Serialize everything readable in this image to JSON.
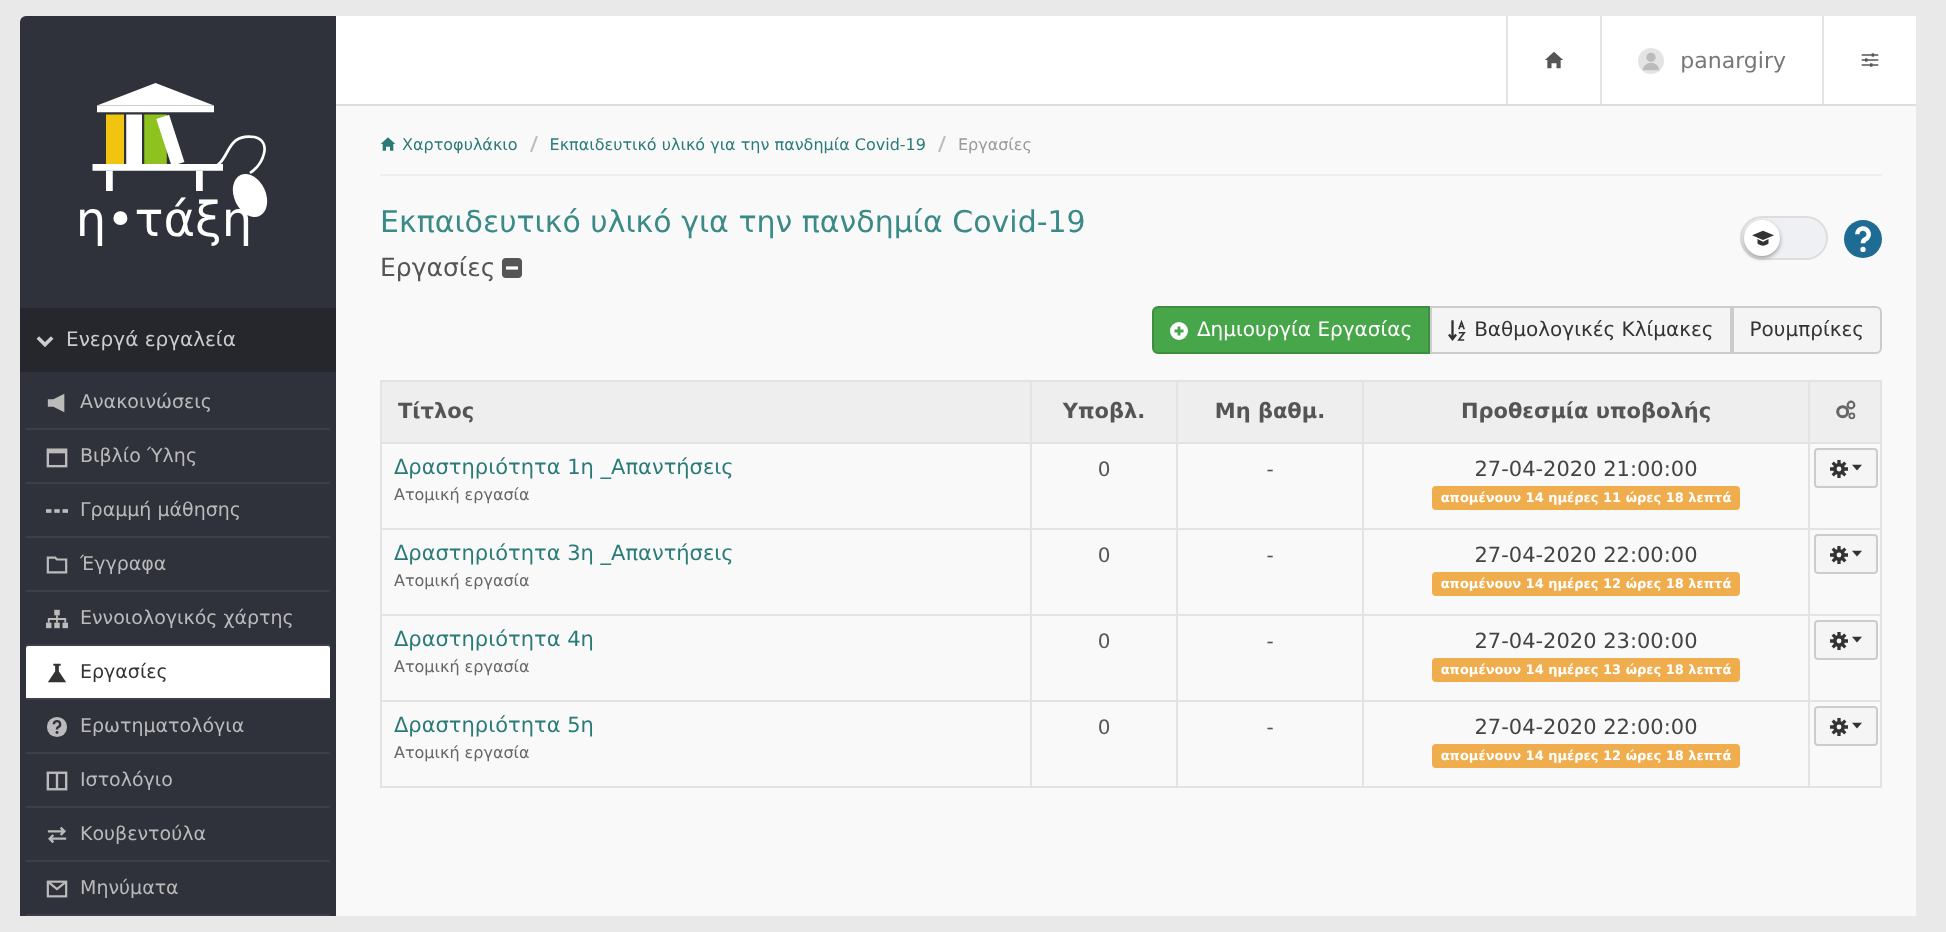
{
  "logo_text": "η•τάξη",
  "sidebar": {
    "section": {
      "label": "Ενεργά εργαλεία",
      "expanded": true
    },
    "items": [
      {
        "label": "Ανακοινώσεις",
        "selected": false
      },
      {
        "label": "Βιβλίο Ύλης",
        "selected": false
      },
      {
        "label": "Γραμμή μάθησης",
        "selected": false
      },
      {
        "label": "Έγγραφα",
        "selected": false
      },
      {
        "label": "Εννοιολογικός χάρτης",
        "selected": false
      },
      {
        "label": "Εργασίες",
        "selected": true
      },
      {
        "label": "Ερωτηματολόγια",
        "selected": false
      },
      {
        "label": "Ιστολόγιο",
        "selected": false
      },
      {
        "label": "Κουβεντούλα",
        "selected": false
      },
      {
        "label": "Μηνύματα",
        "selected": false
      }
    ]
  },
  "topbar": {
    "user": "panargiry"
  },
  "breadcrumb": [
    "Χαρτοφυλάκιο",
    "Εκπαιδευτικό υλικό για την πανδημία Covid-19",
    "Εργασίες"
  ],
  "title": "Εκπαιδευτικό υλικό για την πανδημία Covid-19",
  "subtitle": "Εργασίες",
  "toggle": {
    "on": false
  },
  "buttons": [
    {
      "label": "Δημιουργία Εργασίας",
      "kind": "primary"
    },
    {
      "label": "Βαθμολογικές Κλίμακες",
      "kind": "sort"
    },
    {
      "label": "Ρουμπρίκες",
      "kind": "plain"
    }
  ],
  "table": {
    "columns": [
      "Τίτλος",
      "Υποβλ.",
      "Μη βαθμ.",
      "Προθεσμία υποβολής"
    ],
    "rows": [
      {
        "title": "Δραστηριότητα 1η _Απαντήσεις",
        "type": "Ατομική εργασία",
        "submitted": "0",
        "ungraded": "-",
        "deadline": "27-04-2020 21:00:00",
        "remaining": "απομένουν 14 ημέρες 11 ώρες 18 λεπτά"
      },
      {
        "title": "Δραστηριότητα 3η _Απαντήσεις",
        "type": "Ατομική εργασία",
        "submitted": "0",
        "ungraded": "-",
        "deadline": "27-04-2020 22:00:00",
        "remaining": "απομένουν 14 ημέρες 12 ώρες 18 λεπτά"
      },
      {
        "title": "Δραστηριότητα 4η",
        "type": "Ατομική εργασία",
        "submitted": "0",
        "ungraded": "-",
        "deadline": "27-04-2020 23:00:00",
        "remaining": "απομένουν 14 ημέρες 13 ώρες 18 λεπτά"
      },
      {
        "title": "Δραστηριότητα 5η",
        "type": "Ατομική εργασία",
        "submitted": "0",
        "ungraded": "-",
        "deadline": "27-04-2020 22:00:00",
        "remaining": "απομένουν 14 ημέρες 12 ώρες 18 λεπτά"
      }
    ]
  }
}
